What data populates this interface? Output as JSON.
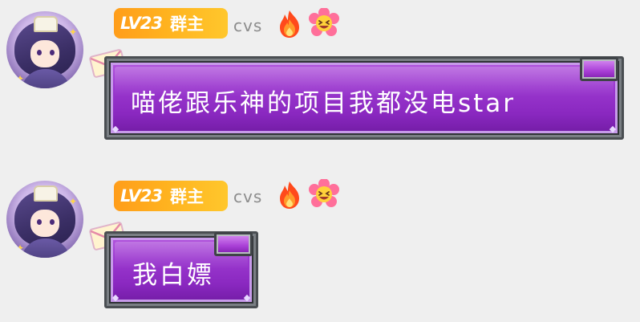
{
  "messages": [
    {
      "level": "LV23",
      "role": "群主",
      "username": "cvs",
      "icons": [
        "fire-icon",
        "flower-emoji-icon",
        "envelope-icon"
      ],
      "text": "喵佬跟乐神的项目我都没电star"
    },
    {
      "level": "LV23",
      "role": "群主",
      "username": "cvs",
      "icons": [
        "fire-icon",
        "flower-emoji-icon",
        "envelope-icon"
      ],
      "text": "我白嫖"
    }
  ],
  "colors": {
    "page_background": "#efefef",
    "badge_gradient_start": "#ff9d1a",
    "badge_gradient_end": "#ffc72c",
    "bubble_purple": "#9b38cf",
    "bubble_frame": "#4a4e52",
    "username_gray": "#8c8c8c"
  }
}
